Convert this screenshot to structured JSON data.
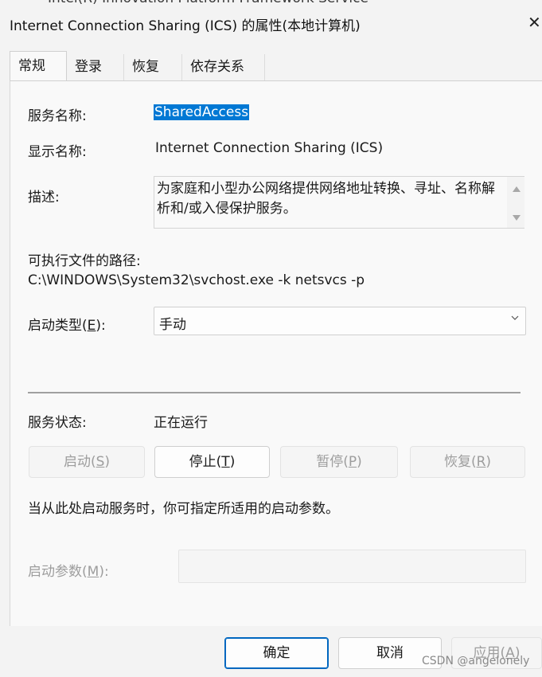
{
  "background_window": {
    "title_peek": "Intel(R) Innovation Platform Framework Service"
  },
  "window": {
    "title": "Internet Connection Sharing (ICS) 的属性(本地计算机)",
    "close_glyph": "✕"
  },
  "tabs": [
    {
      "label": "常规",
      "active": true
    },
    {
      "label": "登录",
      "active": false
    },
    {
      "label": "恢复",
      "active": false
    },
    {
      "label": "依存关系",
      "active": false
    }
  ],
  "general": {
    "service_name_label": "服务名称:",
    "service_name_value": "SharedAccess",
    "display_name_label": "显示名称:",
    "display_name_value": "Internet Connection Sharing (ICS)",
    "description_label": "描述:",
    "description_value": "为家庭和小型办公网络提供网络地址转换、寻址、名称解析和/或入侵保护服务。",
    "exe_path_label": "可执行文件的路径:",
    "exe_path_value": "C:\\WINDOWS\\System32\\svchost.exe -k netsvcs -p",
    "startup_type_label_pre": "启动类型(",
    "startup_type_label_key": "E",
    "startup_type_label_post": "):",
    "startup_type_value": "手动",
    "status_label": "服务状态:",
    "status_value": "正在运行",
    "buttons": {
      "start": {
        "pre": "启动(",
        "key": "S",
        "post": ")"
      },
      "stop": {
        "pre": "停止(",
        "key": "T",
        "post": ")"
      },
      "pause": {
        "pre": "暂停(",
        "key": "P",
        "post": ")"
      },
      "resume": {
        "pre": "恢复(",
        "key": "R",
        "post": ")"
      }
    },
    "hint": "当从此处启动服务时，你可指定所适用的启动参数。",
    "start_params_label_pre": "启动参数(",
    "start_params_label_key": "M",
    "start_params_label_post": "):",
    "start_params_value": ""
  },
  "footer": {
    "ok": "确定",
    "cancel": "取消",
    "apply_pre": "应用(",
    "apply_key": "A",
    "apply_post": ")"
  },
  "watermark": "CSDN @angelonely",
  "colors": {
    "selection": "#0078d4",
    "primary_border": "#0067c0",
    "disabled_text": "#9d9d9d"
  }
}
